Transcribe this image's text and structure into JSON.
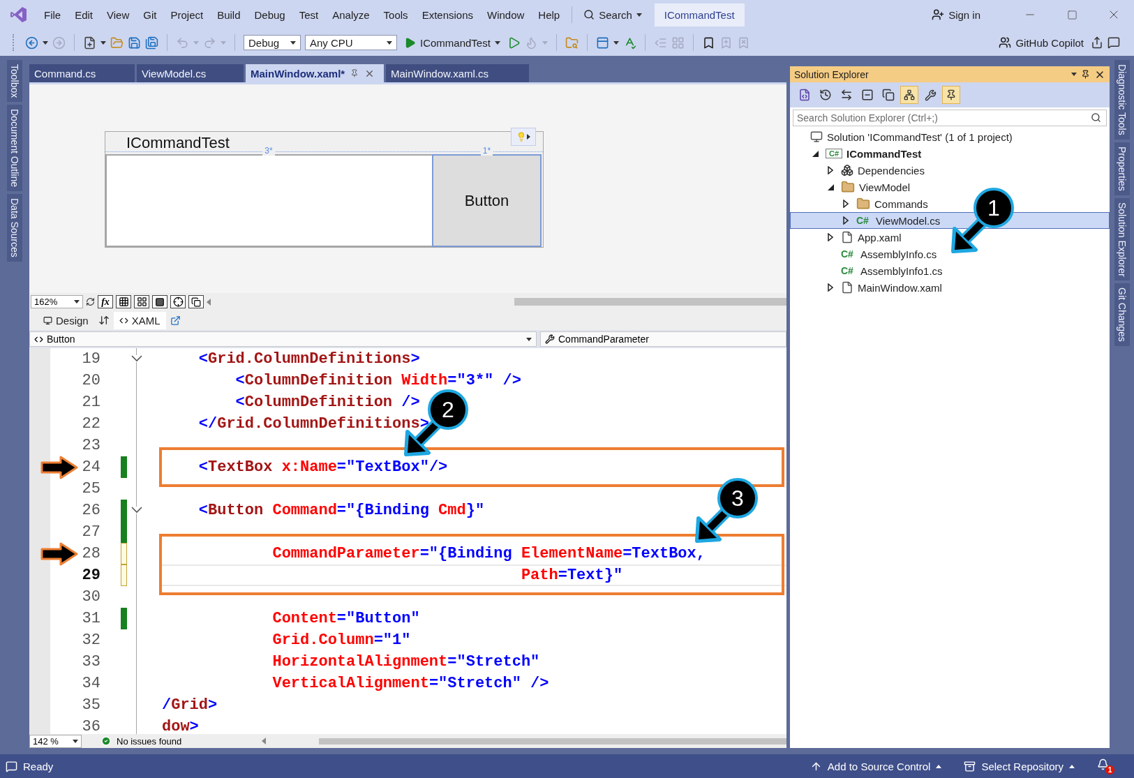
{
  "menu_items": [
    "File",
    "Edit",
    "View",
    "Git",
    "Project",
    "Build",
    "Debug",
    "Test",
    "Analyze",
    "Tools",
    "Extensions",
    "Window",
    "Help"
  ],
  "search": {
    "label": "Search"
  },
  "solution_badge": "ICommandTest",
  "sign_in": "Sign in",
  "toolbar": {
    "configuration": "Debug",
    "platform": "Any CPU",
    "startup": "ICommandTest",
    "copilot": "GitHub Copilot"
  },
  "left_tool_tabs": [
    "Toolbox",
    "Document Outline",
    "Data Sources"
  ],
  "right_tool_tabs": [
    "Diagnostic Tools",
    "Properties",
    "Solution Explorer",
    "Git Changes"
  ],
  "document_tabs": [
    {
      "label": "Command.cs",
      "selected": false
    },
    {
      "label": "ViewModel.cs",
      "selected": false
    },
    {
      "label": "MainWindow.xaml*",
      "selected": true
    },
    {
      "label": "MainWindow.xaml.cs",
      "selected": false
    }
  ],
  "designer": {
    "window_title": "ICommandTest",
    "column_markers": [
      "3*",
      "1*"
    ],
    "button_label": "Button",
    "zoom": "162%",
    "formula_button": "fx"
  },
  "view_tabs": [
    {
      "label": "Design",
      "selected": false
    },
    {
      "label": "XAML",
      "selected": true
    }
  ],
  "navigation": {
    "element": "Button",
    "member": "CommandParameter"
  },
  "code": {
    "lines": [
      {
        "number": "19",
        "current": false,
        "expanded": true,
        "tokens": [
          {
            "kind": "markup",
            "text": "    <"
          },
          {
            "kind": "element",
            "text": "Grid.ColumnDefinitions"
          },
          {
            "kind": "markup",
            "text": ">"
          }
        ]
      },
      {
        "number": "20",
        "current": false,
        "tokens": [
          {
            "kind": "markup",
            "text": "        <"
          },
          {
            "kind": "element",
            "text": "ColumnDefinition"
          },
          {
            "kind": "attribute",
            "text": " Width"
          },
          {
            "kind": "markup",
            "text": "=\"3*\" />"
          }
        ]
      },
      {
        "number": "21",
        "current": false,
        "tokens": [
          {
            "kind": "markup",
            "text": "        <"
          },
          {
            "kind": "element",
            "text": "ColumnDefinition"
          },
          {
            "kind": "markup",
            "text": " />"
          }
        ]
      },
      {
        "number": "22",
        "current": false,
        "tokens": [
          {
            "kind": "markup",
            "text": "    </"
          },
          {
            "kind": "element",
            "text": "Grid.ColumnDefinitions"
          },
          {
            "kind": "markup",
            "text": ">"
          }
        ]
      },
      {
        "number": "23",
        "current": false
      },
      {
        "number": "24",
        "current": false,
        "changed": true,
        "saved": true,
        "boxed": true,
        "arrow": true,
        "tokens": [
          {
            "kind": "markup",
            "text": "    <"
          },
          {
            "kind": "element",
            "text": "TextBox"
          },
          {
            "kind": "attribute",
            "text": " x:Name"
          },
          {
            "kind": "markup",
            "text": "=\"TextBox\"/>"
          }
        ]
      },
      {
        "number": "25",
        "current": false
      },
      {
        "number": "26",
        "current": false,
        "changed": true,
        "saved": true,
        "expanded": true,
        "tokens": [
          {
            "kind": "markup",
            "text": "    <"
          },
          {
            "kind": "element",
            "text": "Button"
          },
          {
            "kind": "attribute",
            "text": " Command"
          },
          {
            "kind": "markup",
            "text": "=\"{Binding "
          },
          {
            "kind": "attribute",
            "text": "Cmd"
          },
          {
            "kind": "markup",
            "text": "}\""
          }
        ]
      },
      {
        "number": "27",
        "current": false,
        "changed": true,
        "saved": true
      },
      {
        "number": "28",
        "current": false,
        "changed": true,
        "saved": false,
        "boxed": true,
        "arrow": true,
        "tokens": [
          {
            "kind": "attribute",
            "text": "            CommandParameter"
          },
          {
            "kind": "markup",
            "text": "=\"{Binding "
          },
          {
            "kind": "attribute",
            "text": "ElementName"
          },
          {
            "kind": "markup",
            "text": "=TextBox,"
          }
        ]
      },
      {
        "number": "29",
        "current": true,
        "changed": true,
        "saved": false,
        "boxed": true,
        "tokens": [
          {
            "kind": "attribute",
            "text": "                                       Path"
          },
          {
            "kind": "markup",
            "text": "=Text}\""
          }
        ]
      },
      {
        "number": "30",
        "current": false
      },
      {
        "number": "31",
        "current": false,
        "changed": true,
        "saved": true,
        "tokens": [
          {
            "kind": "attribute",
            "text": "            Content"
          },
          {
            "kind": "markup",
            "text": "=\"Button\""
          }
        ]
      },
      {
        "number": "32",
        "current": false,
        "tokens": [
          {
            "kind": "attribute",
            "text": "            Grid.Column"
          },
          {
            "kind": "markup",
            "text": "=\"1\""
          }
        ]
      },
      {
        "number": "33",
        "current": false,
        "tokens": [
          {
            "kind": "attribute",
            "text": "            HorizontalAlignment"
          },
          {
            "kind": "markup",
            "text": "=\"Stretch\""
          }
        ]
      },
      {
        "number": "34",
        "current": false,
        "tokens": [
          {
            "kind": "attribute",
            "text": "            VerticalAlignment"
          },
          {
            "kind": "markup",
            "text": "=\"Stretch\" />"
          }
        ]
      },
      {
        "number": "35",
        "current": false,
        "tokens": [
          {
            "kind": "markup",
            "text": "/"
          },
          {
            "kind": "element",
            "text": "Grid"
          },
          {
            "kind": "markup",
            "text": ">"
          }
        ]
      },
      {
        "number": "36",
        "current": false,
        "tokens": [
          {
            "kind": "element",
            "text": "dow"
          },
          {
            "kind": "markup",
            "text": ">"
          }
        ]
      }
    ],
    "zoom": "142 %",
    "issues": "No issues found"
  },
  "solution_explorer": {
    "title": "Solution Explorer",
    "toolbar": [
      {
        "kind": "switch-views",
        "on": false
      },
      {
        "kind": "history",
        "on": false
      },
      {
        "kind": "sync",
        "on": false
      },
      {
        "kind": "collapse",
        "on": false
      },
      {
        "kind": "show-all",
        "on": false
      },
      {
        "kind": "filter",
        "on": true
      },
      {
        "kind": "properties",
        "on": false
      },
      {
        "kind": "preview",
        "on": true
      }
    ],
    "search": {
      "placeholder": "Search Solution Explorer (Ctrl+;)"
    },
    "tree": [
      {
        "label": "Solution 'ICommandTest' (1 of 1 project)",
        "kind": "solution",
        "selected": false,
        "children": [
          {
            "label": "ICommandTest",
            "kind": "project",
            "icon_label": "C#",
            "expanded": true,
            "selected": false,
            "children": [
              {
                "label": "Dependencies",
                "kind": "dependencies",
                "expanded": false,
                "selected": false
              },
              {
                "label": "ViewModel",
                "kind": "folder",
                "expanded": true,
                "selected": false,
                "children": [
                  {
                    "label": "Commands",
                    "kind": "folder",
                    "expanded": false,
                    "selected": false
                  },
                  {
                    "label": "ViewModel.cs",
                    "kind": "csharp",
                    "icon_label": "C#",
                    "expanded": false,
                    "selected": true
                  }
                ]
              },
              {
                "label": "App.xaml",
                "kind": "xaml",
                "expanded": false,
                "selected": false
              },
              {
                "label": "AssemblyInfo.cs",
                "kind": "csharp",
                "icon_label": "C#",
                "selected": false
              },
              {
                "label": "AssemblyInfo1.cs",
                "kind": "csharp",
                "icon_label": "C#",
                "selected": false
              },
              {
                "label": "MainWindow.xaml",
                "kind": "xaml",
                "expanded": false,
                "selected": false
              }
            ]
          }
        ]
      }
    ]
  },
  "callouts": [
    "1",
    "2",
    "3"
  ],
  "status_bar": {
    "message": "Ready",
    "source_control": "Add to Source Control",
    "repository": "Select Repository",
    "notifications": "1"
  }
}
